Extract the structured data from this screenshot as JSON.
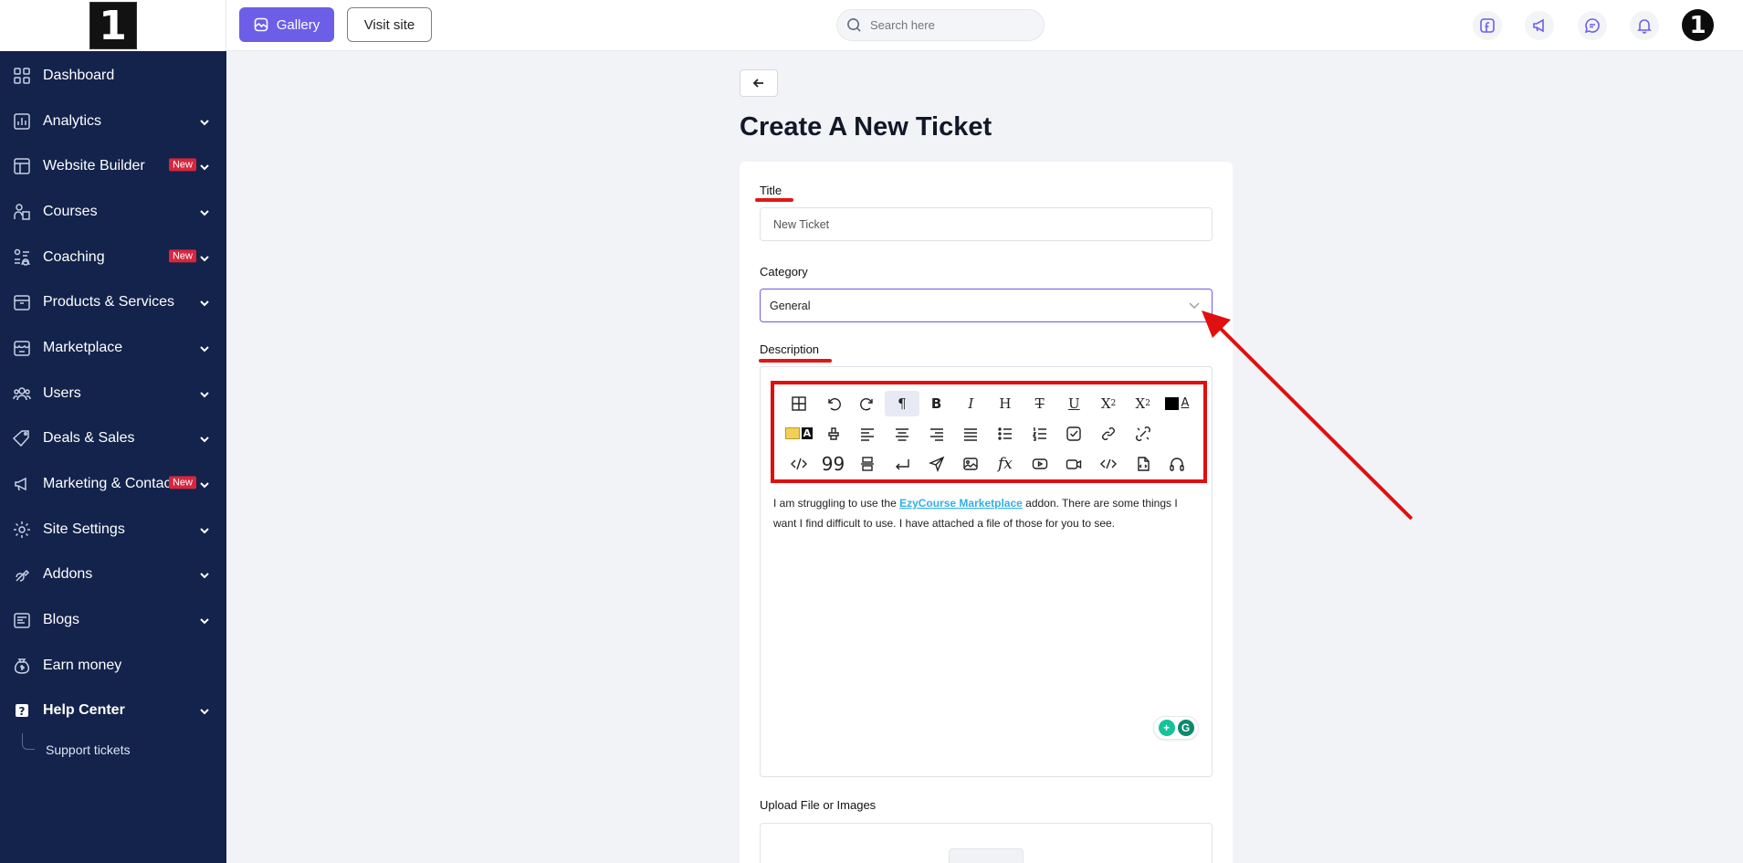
{
  "sidebar": {
    "logo_text": "1",
    "items": [
      {
        "label": "Dashboard",
        "icon": "dashboard-icon",
        "has_chevron": false,
        "badge": ""
      },
      {
        "label": "Analytics",
        "icon": "analytics-icon",
        "has_chevron": true,
        "badge": ""
      },
      {
        "label": "Website Builder",
        "icon": "website-builder-icon",
        "has_chevron": true,
        "badge": "New"
      },
      {
        "label": "Courses",
        "icon": "courses-icon",
        "has_chevron": true,
        "badge": ""
      },
      {
        "label": "Coaching",
        "icon": "coaching-icon",
        "has_chevron": true,
        "badge": "New"
      },
      {
        "label": "Products & Services",
        "icon": "products-icon",
        "has_chevron": true,
        "badge": ""
      },
      {
        "label": "Marketplace",
        "icon": "marketplace-icon",
        "has_chevron": true,
        "badge": ""
      },
      {
        "label": "Users",
        "icon": "users-icon",
        "has_chevron": true,
        "badge": ""
      },
      {
        "label": "Deals & Sales",
        "icon": "tag-icon",
        "has_chevron": true,
        "badge": ""
      },
      {
        "label": "Marketing & Contacts",
        "icon": "megaphone-icon",
        "has_chevron": true,
        "badge": "New"
      },
      {
        "label": "Site Settings",
        "icon": "gear-icon",
        "has_chevron": true,
        "badge": ""
      },
      {
        "label": "Addons",
        "icon": "addons-icon",
        "has_chevron": true,
        "badge": ""
      },
      {
        "label": "Blogs",
        "icon": "blog-icon",
        "has_chevron": true,
        "badge": ""
      },
      {
        "label": "Earn money",
        "icon": "money-bag-icon",
        "has_chevron": false,
        "badge": ""
      },
      {
        "label": "Help Center",
        "icon": "help-icon",
        "has_chevron": true,
        "badge": ""
      }
    ],
    "sub_items": [
      {
        "label": "Support tickets"
      }
    ]
  },
  "topbar": {
    "gallery_label": "Gallery",
    "visit_label": "Visit site",
    "search_placeholder": "Search here",
    "avatar_text": "1"
  },
  "page": {
    "title": "Create A New Ticket",
    "title_label": "Title",
    "title_value": "New Ticket",
    "category_label": "Category",
    "category_value": "General",
    "description_label": "Description",
    "description_before_link": "I am struggling to use the ",
    "description_link": "EzyCourse Marketplace",
    "description_after_link": " addon. There are some things I want I find difficult to use. I have attached a file of those for you to see.",
    "upload_label": "Upload File or Images"
  },
  "colors": {
    "sidebar_bg": "#13234b",
    "accent": "#6d5ee8",
    "annotation_red": "#e01010",
    "badge_red": "#d7263d",
    "link": "#32b0e6"
  }
}
